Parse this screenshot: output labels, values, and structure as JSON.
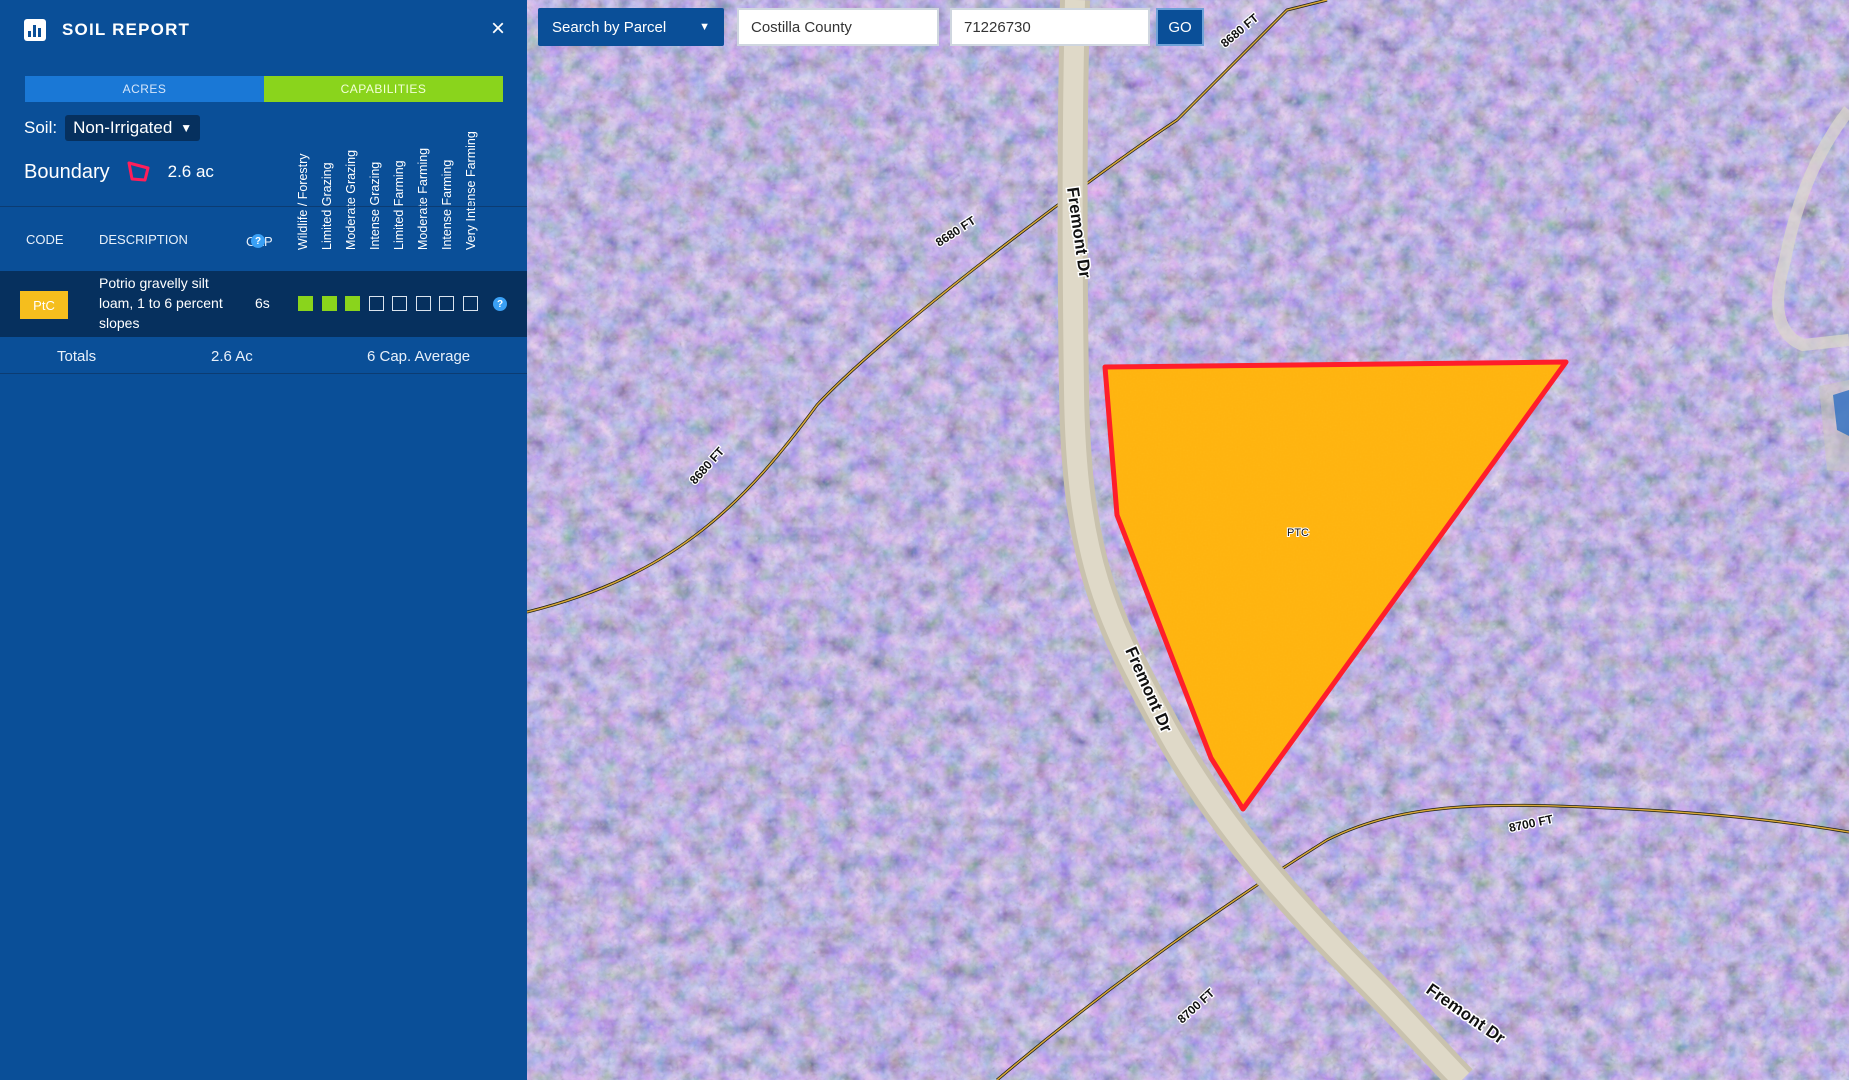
{
  "panel": {
    "title": "SOIL REPORT",
    "close_label": "×",
    "tabs": {
      "acres": "ACRES",
      "capabilities": "CAPABILITIES"
    },
    "soil_label": "Soil:",
    "soil_value": "Non-Irrigated",
    "boundary_label": "Boundary",
    "boundary_acreage": "2.6 ac",
    "capability_headers": [
      "Wildlife / Forestry",
      "Limited Grazing",
      "Moderate Grazing",
      "Intense Grazing",
      "Limited Farming",
      "Moderate Farming",
      "Intense Farming",
      "Very Intense Farming"
    ],
    "columns": {
      "code": "CODE",
      "description": "DESCRIPTION",
      "cap": "CAP"
    },
    "rows": [
      {
        "code": "PtC",
        "description": "Potrio gravelly silt loam, 1 to 6 percent slopes",
        "cap": "6s",
        "capability_filled": 3,
        "capability_total": 8
      }
    ],
    "totals": {
      "label": "Totals",
      "acres": "2.6 Ac",
      "cap_average": "6 Cap. Average"
    }
  },
  "toolbar": {
    "search_type": "Search by Parcel",
    "county_value": "Costilla County",
    "parcel_value": "71226730",
    "go_label": "GO"
  },
  "map": {
    "road_labels": [
      "Fremont Dr",
      "Fremont Dr",
      "Fremont Dr"
    ],
    "contour_labels": [
      "8680 FT",
      "8680 FT",
      "8680 FT",
      "8700 FT",
      "8700 FT"
    ],
    "parcel_label": "PTC",
    "colors": {
      "parcel_fill": "#ffb20d",
      "parcel_outline": "#ff1e2a",
      "panel": "#0a4f98",
      "capability_green": "#8ad41c",
      "code_badge": "#f5be1d"
    }
  }
}
